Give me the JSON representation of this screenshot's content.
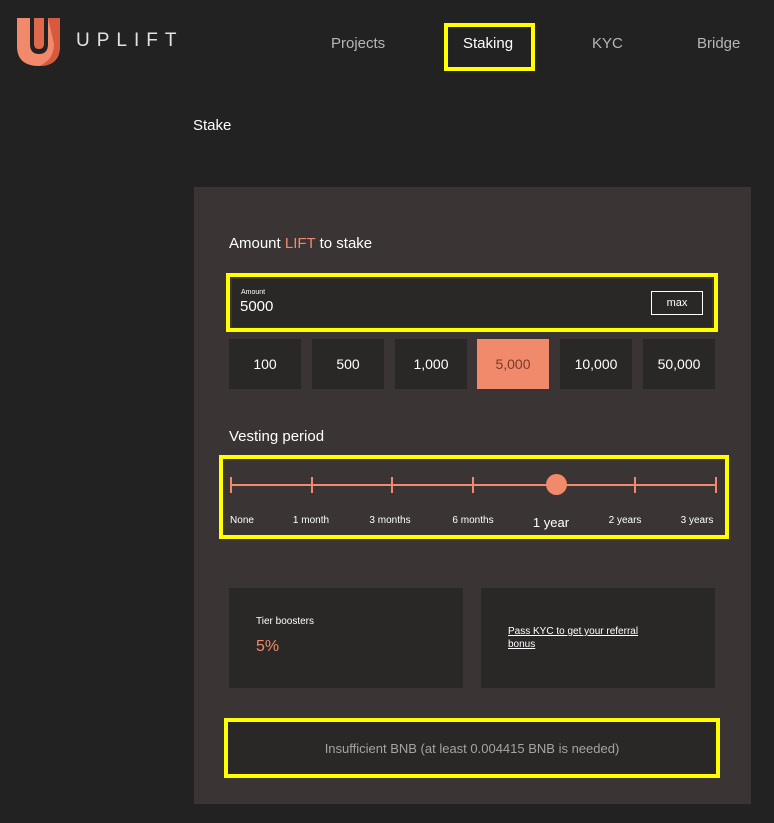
{
  "header": {
    "logo_text": "UPLIFT",
    "nav": {
      "projects": "Projects",
      "staking": "Staking",
      "kyc": "KYC",
      "bridge": "Bridge"
    }
  },
  "page": {
    "heading": "Stake"
  },
  "amount": {
    "label_prefix": "Amount ",
    "label_token": "LIFT",
    "label_suffix": " to stake",
    "field_label": "Amount",
    "value": "5000",
    "max_label": "max",
    "presets": [
      "100",
      "500",
      "1,000",
      "5,000",
      "10,000",
      "50,000"
    ],
    "selected_preset": "5,000"
  },
  "vesting": {
    "label": "Vesting period",
    "options": [
      "None",
      "1 month",
      "3 months",
      "6 months",
      "1 year",
      "2 years",
      "3 years"
    ],
    "selected": "1 year",
    "selected_index": 4
  },
  "tier": {
    "title": "Tier boosters",
    "value": "5%"
  },
  "referral": {
    "link_text": "Pass KYC to get your referral bonus"
  },
  "status": {
    "message": "Insufficient BNB (at least 0.004415 BNB is needed)"
  },
  "colors": {
    "accent": "#f18a6b",
    "highlight": "#ffff00",
    "background": "#232222",
    "panel": "#3a3534"
  }
}
